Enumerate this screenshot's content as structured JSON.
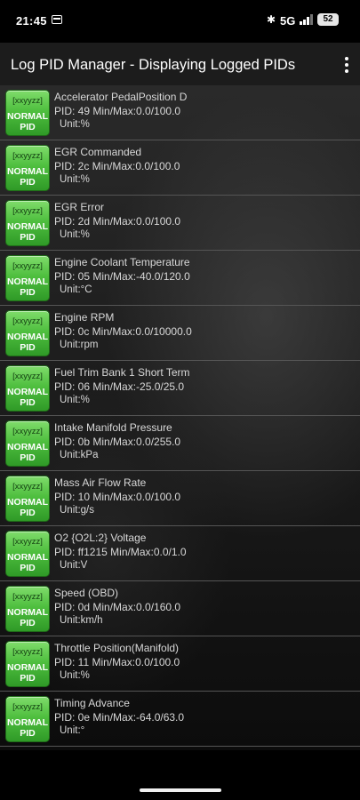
{
  "status_bar": {
    "time": "21:45",
    "network": "5G",
    "battery": "52"
  },
  "app_bar": {
    "title": "Log PID Manager - Displaying Logged PIDs"
  },
  "badge": {
    "top_label": "[xxyyzz]",
    "line1": "NORMAL",
    "line2": "PID"
  },
  "colors": {
    "badge_green": "#4fbf3f",
    "app_bar": "#1c1c1c",
    "divider": "#555555"
  },
  "pids": [
    {
      "name": "Accelerator PedalPosition D",
      "detail": "PID: 49   Min/Max:0.0/100.0",
      "unit": "Unit:%"
    },
    {
      "name": "EGR Commanded",
      "detail": "PID: 2c   Min/Max:0.0/100.0",
      "unit": "Unit:%"
    },
    {
      "name": "EGR Error",
      "detail": "PID: 2d   Min/Max:0.0/100.0",
      "unit": "Unit:%"
    },
    {
      "name": "Engine Coolant Temperature",
      "detail": "PID: 05   Min/Max:-40.0/120.0",
      "unit": "Unit:°C"
    },
    {
      "name": "Engine RPM",
      "detail": "PID: 0c   Min/Max:0.0/10000.0",
      "unit": "Unit:rpm"
    },
    {
      "name": "Fuel Trim Bank 1 Short Term",
      "detail": "PID: 06   Min/Max:-25.0/25.0",
      "unit": "Unit:%"
    },
    {
      "name": "Intake Manifold Pressure",
      "detail": "PID: 0b   Min/Max:0.0/255.0",
      "unit": "Unit:kPa"
    },
    {
      "name": "Mass Air Flow Rate",
      "detail": "PID: 10   Min/Max:0.0/100.0",
      "unit": "Unit:g/s"
    },
    {
      "name": "O2 {O2L:2} Voltage",
      "detail": "PID: ff1215   Min/Max:0.0/1.0",
      "unit": "Unit:V"
    },
    {
      "name": "Speed (OBD)",
      "detail": "PID: 0d   Min/Max:0.0/160.0",
      "unit": "Unit:km/h"
    },
    {
      "name": "Throttle Position(Manifold)",
      "detail": "PID: 11   Min/Max:0.0/100.0",
      "unit": "Unit:%"
    },
    {
      "name": "Timing Advance",
      "detail": "PID: 0e   Min/Max:-64.0/63.0",
      "unit": "Unit:°"
    }
  ]
}
